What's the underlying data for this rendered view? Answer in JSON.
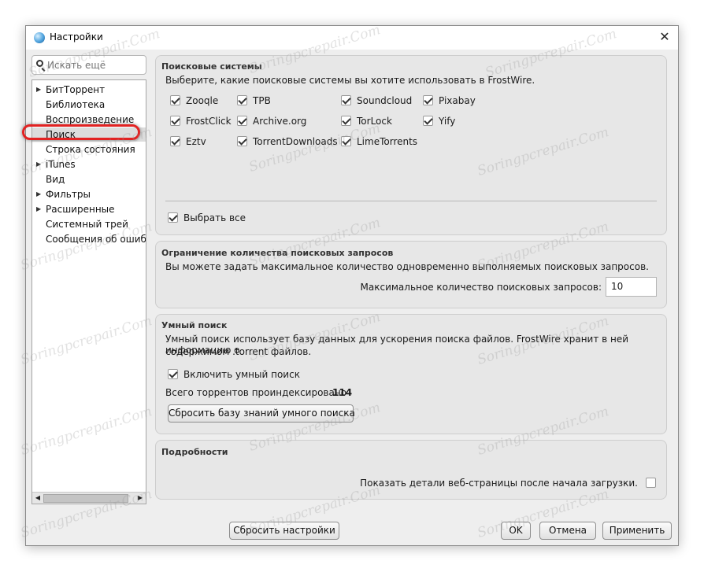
{
  "window": {
    "title": "Настройки",
    "close_glyph": "✕",
    "app_icon": "frostwire-globe-icon"
  },
  "sidebar": {
    "search_placeholder": "Искать ещё",
    "items": [
      {
        "label": "БитТоррент",
        "expandable": true
      },
      {
        "label": "Библиотека",
        "expandable": false
      },
      {
        "label": "Воспроизведение",
        "expandable": false
      },
      {
        "label": "Поиск",
        "expandable": false,
        "selected": true
      },
      {
        "label": "Строка состояния",
        "expandable": false
      },
      {
        "label": "iTunes",
        "expandable": true
      },
      {
        "label": "Вид",
        "expandable": false
      },
      {
        "label": "Фильтры",
        "expandable": true
      },
      {
        "label": "Расширенные",
        "expandable": true
      },
      {
        "label": "Системный трей",
        "expandable": false
      },
      {
        "label": "Сообщения об ошибках",
        "expandable": false
      }
    ],
    "expand_glyph": "▶",
    "scroll_left": "◀",
    "scroll_right": "▶"
  },
  "search_engines": {
    "title": "Поисковые системы",
    "description": "Выберите, какие поисковые системы вы хотите использовать в FrostWire.",
    "engines": [
      {
        "label": "Zooqle",
        "checked": true
      },
      {
        "label": "TPB",
        "checked": true
      },
      {
        "label": "Soundcloud",
        "checked": true
      },
      {
        "label": "Pixabay",
        "checked": true
      },
      {
        "label": "FrostClick",
        "checked": true
      },
      {
        "label": "Archive.org",
        "checked": true
      },
      {
        "label": "TorLock",
        "checked": true
      },
      {
        "label": "Yify",
        "checked": true
      },
      {
        "label": "Eztv",
        "checked": true
      },
      {
        "label": "TorrentDownloads",
        "checked": true
      },
      {
        "label": "LimeTorrents",
        "checked": true
      }
    ],
    "select_all": {
      "label": "Выбрать все",
      "checked": true
    }
  },
  "query_limit": {
    "title": "Ограничение количества поисковых запросов",
    "description": "Вы можете задать максимальное количество одновременно выполняемых поисковых запросов.",
    "field_label": "Максимальное количество поисковых запросов:",
    "field_value": "10"
  },
  "smart_search": {
    "title": "Умный поиск",
    "description_line1": "Умный поиск использует базу данных для ускорения поиска файлов. FrostWire хранит в ней информацию о",
    "description_line2": "содержимом .torrent файлов.",
    "enable": {
      "label": "Включить умный поиск",
      "checked": true
    },
    "indexed_label": "Всего торрентов проиндексировано",
    "indexed_count": "114",
    "reset_button": "Сбросить базу знаний умного поиска"
  },
  "details": {
    "title": "Подробности",
    "show_details": {
      "label": "Показать детали веб-страницы после начала загрузки.",
      "checked": false
    }
  },
  "footer": {
    "reset_settings": "Сбросить настройки",
    "ok": "OK",
    "cancel": "Отмена",
    "apply": "Применить"
  },
  "watermark_text": "Soringpcrepair.Com"
}
